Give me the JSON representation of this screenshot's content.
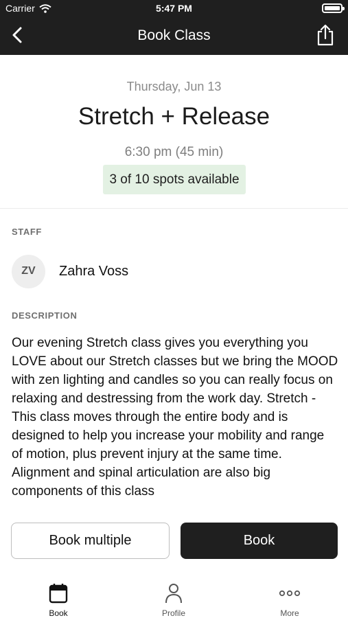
{
  "status_bar": {
    "carrier": "Carrier",
    "time": "5:47 PM"
  },
  "nav": {
    "title": "Book Class"
  },
  "class_info": {
    "date": "Thursday, Jun 13",
    "name": "Stretch + Release",
    "time": "6:30 pm (45 min)",
    "spots": "3 of 10 spots available"
  },
  "staff": {
    "label": "STAFF",
    "initials": "ZV",
    "name": "Zahra Voss"
  },
  "description": {
    "label": "DESCRIPTION",
    "text": "Our evening Stretch class gives you everything you LOVE about our Stretch classes but we bring the MOOD with zen lighting and candles so you can really focus on relaxing and destressing from the work day.   Stretch - This class moves through the entire body and is designed to help you increase your mobility and range of motion, plus prevent injury at the same time. Alignment and spinal articulation are also big components of this class"
  },
  "actions": {
    "book_multiple": "Book multiple",
    "book": "Book"
  },
  "tabbar": {
    "items": [
      {
        "label": "Book",
        "icon": "calendar-icon",
        "active": true
      },
      {
        "label": "Profile",
        "icon": "person-icon",
        "active": false
      },
      {
        "label": "More",
        "icon": "ellipsis-icon",
        "active": false
      }
    ]
  },
  "colors": {
    "bar_background": "#1f1f1f",
    "spots_badge": "#e3f1e3",
    "book_button": "#1f1f1f"
  }
}
